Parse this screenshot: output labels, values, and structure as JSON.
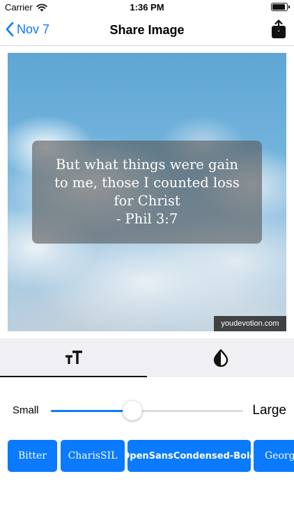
{
  "status_bar": {
    "carrier": "Carrier",
    "time": "1:36 PM",
    "battery_level": 0.9
  },
  "nav": {
    "back_label": "Nov 7",
    "title": "Share Image",
    "back_icon": "chevron-left-icon",
    "share_icon": "share-icon"
  },
  "preview": {
    "verse_lines": [
      "But what things were gain",
      "to me, those I counted loss",
      "for Christ"
    ],
    "reference": "- Phil 3:7",
    "watermark": "youdevotion.com"
  },
  "tabs": [
    {
      "name": "text-size",
      "icon": "text-size-icon",
      "selected": true
    },
    {
      "name": "color",
      "icon": "contrast-drop-icon",
      "selected": false
    }
  ],
  "slider": {
    "min_label": "Small",
    "max_label": "Large",
    "value": 0.425
  },
  "fonts": [
    {
      "label": "Bitter"
    },
    {
      "label": "CharisSIL"
    },
    {
      "label": "OpenSansCondensed-Bold"
    },
    {
      "label": "Georgi"
    }
  ],
  "colors": {
    "accent": "#0a7aff",
    "tab_background": "#efeff4",
    "verse_overlay": "#585858"
  }
}
